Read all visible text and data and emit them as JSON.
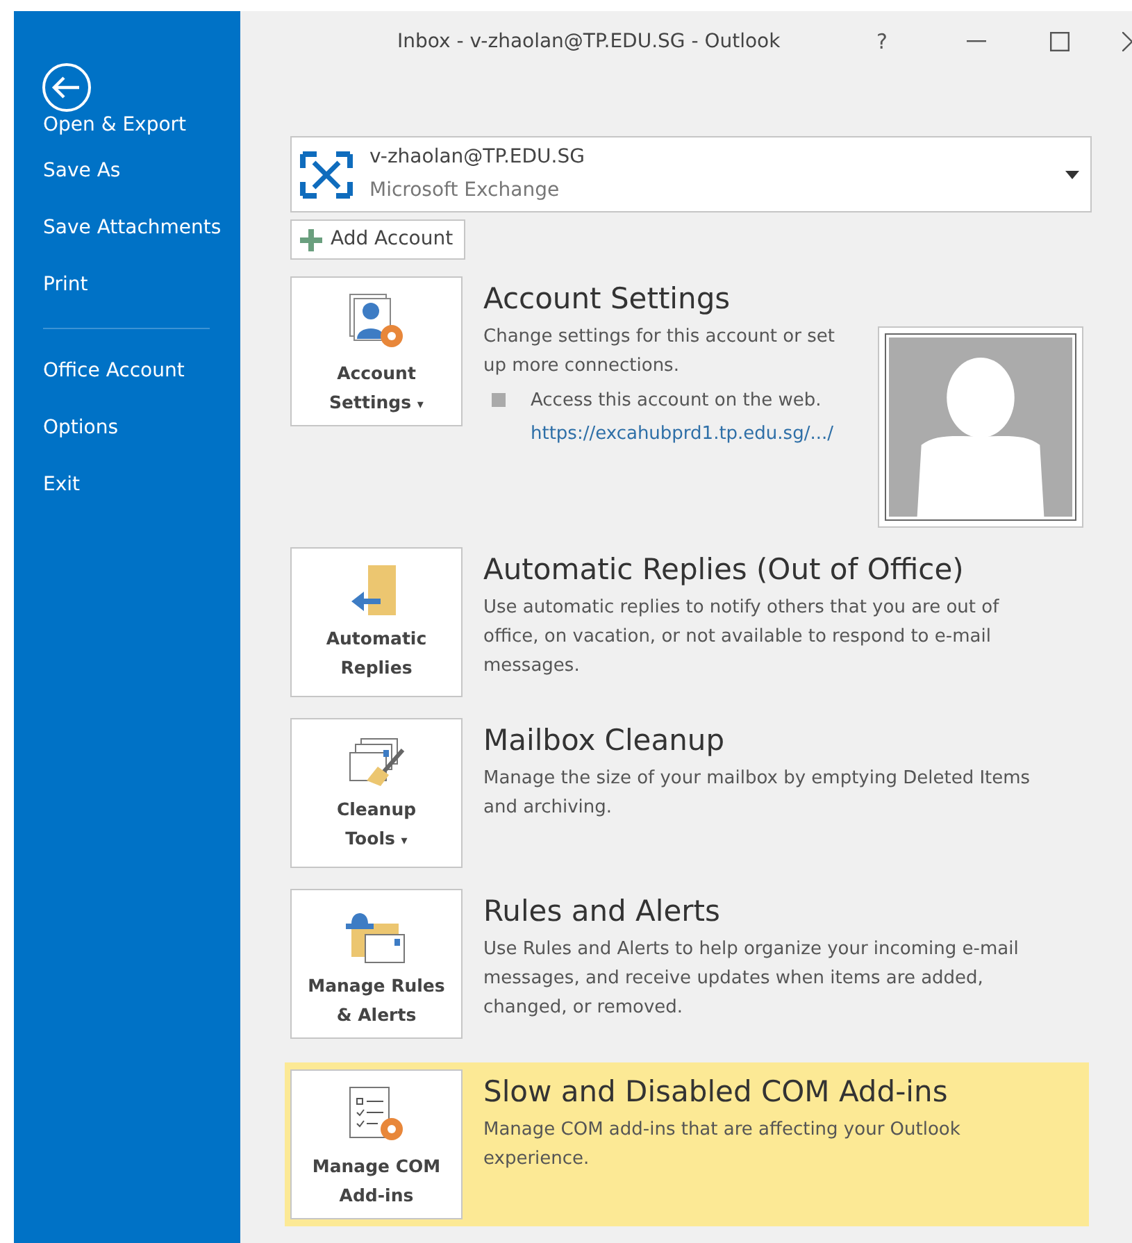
{
  "window": {
    "title": "Inbox - v-zhaolan@TP.EDU.SG - Outlook",
    "help": "?"
  },
  "sidebar": {
    "groups": [
      {
        "items": [
          {
            "label": "Open & Export"
          },
          {
            "label": "Save As"
          },
          {
            "label": "Save Attachments"
          },
          {
            "label": "Print"
          }
        ]
      },
      {
        "items": [
          {
            "label": "Office Account"
          },
          {
            "label": "Options"
          },
          {
            "label": "Exit"
          }
        ]
      }
    ]
  },
  "account": {
    "email": "v-zhaolan@TP.EDU.SG",
    "type": "Microsoft Exchange",
    "add_label": "Add Account"
  },
  "sections": [
    {
      "kind": "account",
      "tile": [
        "Account",
        "Settings"
      ],
      "caret": "▾",
      "highlighted": false,
      "title": "Account Settings",
      "description": "Change settings for this account or set up more connections.",
      "web_access": {
        "text": "Access this account on the web.",
        "link": "https://excahubprd1.tp.edu.sg/.../"
      }
    },
    {
      "kind": "replies",
      "tile": [
        "Automatic",
        "Replies"
      ],
      "highlighted": false,
      "title": "Automatic Replies (Out of Office)",
      "description": "Use automatic replies to notify others that you are out of office, on vacation, or not available to respond to e-mail messages."
    },
    {
      "kind": "cleanup",
      "tile": [
        "Cleanup",
        "Tools"
      ],
      "caret": "▾",
      "highlighted": false,
      "title": "Mailbox Cleanup",
      "description": "Manage the size of your mailbox by emptying Deleted Items and archiving."
    },
    {
      "kind": "rules",
      "tile": [
        "Manage Rules",
        "& Alerts"
      ],
      "highlighted": false,
      "title": "Rules and Alerts",
      "description": "Use Rules and Alerts to help organize your incoming e-mail messages, and receive updates when items are added, changed, or removed."
    },
    {
      "kind": "addins",
      "tile": [
        "Manage COM",
        "Add-ins"
      ],
      "highlighted": true,
      "title": "Slow and Disabled COM Add-ins",
      "description": "Manage COM add-ins that are affecting your Outlook experience."
    }
  ]
}
